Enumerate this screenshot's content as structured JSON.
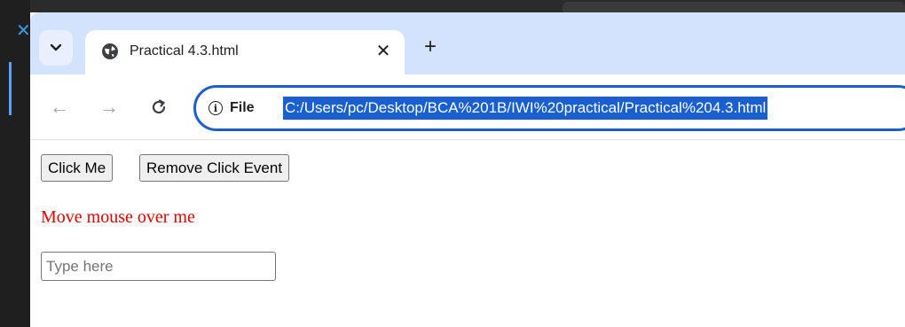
{
  "tab": {
    "title": "Practical 4.3.html",
    "search_icon": "chevron-down-icon",
    "close_glyph": "✕",
    "new_tab_glyph": "+"
  },
  "toolbar": {
    "back_glyph": "←",
    "forward_glyph": "→",
    "reload_glyph": "C",
    "site_info_label": "File",
    "url": "C:/Users/pc/Desktop/BCA%201B/IWI%20practical/Practical%204.3.html"
  },
  "page": {
    "click_button_label": "Click Me",
    "remove_button_label": "Remove Click Event",
    "hover_text": "Move mouse over me",
    "input_value": "",
    "input_placeholder": "Type here"
  },
  "colors": {
    "tabstrip_bg": "#d3e3fd",
    "omnibox_border": "#1a5fcf",
    "url_highlight": "#1a5fcf",
    "hover_text": "#e00000"
  }
}
